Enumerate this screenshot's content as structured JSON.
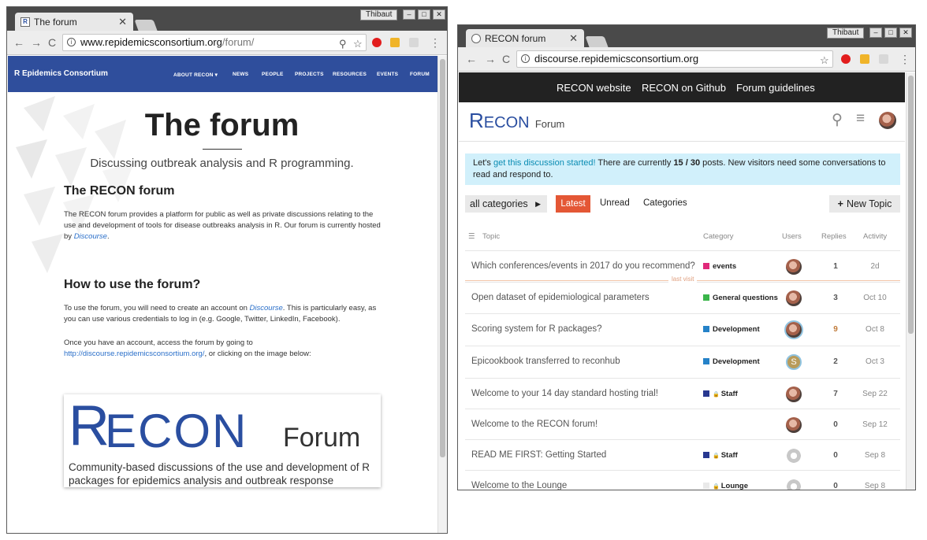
{
  "left": {
    "tab_title": "The forum",
    "user": "Thibaut",
    "url_host": "www.repidemicsconsortium.org",
    "url_path": "/forum/",
    "brand": "R Epidemics Consortium",
    "nav": [
      "ABOUT RECON ▾",
      "NEWS",
      "PEOPLE",
      "PROJECTS",
      "RESOURCES",
      "EVENTS",
      "FORUM"
    ],
    "title": "The forum",
    "subtitle": "Discussing outbreak analysis and R programming.",
    "section1_heading": "The RECON forum",
    "section1_text_a": "The RECON forum provides a platform for public as well as private discussions relating to the use and development of tools for disease outbreaks analysis in R. Our forum is currently hosted by ",
    "section1_link": "Discourse",
    "section1_text_b": ".",
    "section2_heading": "How to use the forum?",
    "section2_text_a": "To use the forum, you will need to create an account on ",
    "section2_link": "Discourse",
    "section2_text_b": ". This is particularly easy, as you can use various credentials to log in (e.g. Google, Twitter, LinkedIn, Facebook).",
    "section2_text2_a": "Once you have an account, access the forum by going to ",
    "section2_link2": "http://discourse.repidemicsconsortium.org/",
    "section2_text2_b": ", or clicking on the image below:",
    "logo_r": "R",
    "logo_econ": "ECON",
    "logo_forum": "Forum",
    "logo_desc": "Community-based discussions of the use and development of R packages for epidemics analysis and outbreak response"
  },
  "right": {
    "tab_title": "RECON forum",
    "user": "Thibaut",
    "url": "discourse.repidemicsconsortium.org",
    "nav": [
      "RECON website",
      "RECON on Github",
      "Forum guidelines"
    ],
    "logo_r": "R",
    "logo_econ": "ECON",
    "logo_forum": "Forum",
    "banner_a": "Let's ",
    "banner_link": "get this discussion started!",
    "banner_b": " There are currently ",
    "banner_count": "15 / 30",
    "banner_c": " posts. New visitors need some conversations to read and respond to.",
    "all_categories": "all categories",
    "latest": "Latest",
    "unread": "Unread",
    "categories": "Categories",
    "new_topic": "New Topic",
    "headers": {
      "topic": "Topic",
      "category": "Category",
      "users": "Users",
      "replies": "Replies",
      "activity": "Activity"
    },
    "last_visit": "last visit",
    "topics": [
      {
        "title": "Which conferences/events in 2017 do you recommend?",
        "category": "events",
        "color": "#e0297a",
        "locked": false,
        "replies": "1",
        "activity": "2d",
        "avatar": "photo"
      },
      {
        "title": "Open dataset of epidemiological parameters",
        "category": "General questions",
        "color": "#3ab54a",
        "locked": false,
        "replies": "3",
        "activity": "Oct 10",
        "avatar": "photo"
      },
      {
        "title": "Scoring system for R packages?",
        "category": "Development",
        "color": "#2582c8",
        "locked": false,
        "replies": "9",
        "activity": "Oct 8",
        "avatar": "photo"
      },
      {
        "title": "Epicookbook transferred to reconhub",
        "category": "Development",
        "color": "#2582c8",
        "locked": false,
        "replies": "2",
        "activity": "Oct 3",
        "avatar": "letter"
      },
      {
        "title": "Welcome to your 14 day standard hosting trial!",
        "category": "Staff",
        "color": "#283890",
        "locked": true,
        "replies": "7",
        "activity": "Sep 22",
        "avatar": "photo"
      },
      {
        "title": "Welcome to the RECON forum!",
        "category": "",
        "color": "",
        "locked": false,
        "replies": "0",
        "activity": "Sep 12",
        "avatar": "photo"
      },
      {
        "title": "READ ME FIRST: Getting Started",
        "category": "Staff",
        "color": "#283890",
        "locked": true,
        "replies": "0",
        "activity": "Sep 8",
        "avatar": "gear"
      },
      {
        "title": "Welcome to the Lounge",
        "category": "Lounge",
        "color": "#e9e9e9",
        "locked": true,
        "replies": "0",
        "activity": "Sep 8",
        "avatar": "gear"
      }
    ],
    "letter_avatar": "S"
  }
}
